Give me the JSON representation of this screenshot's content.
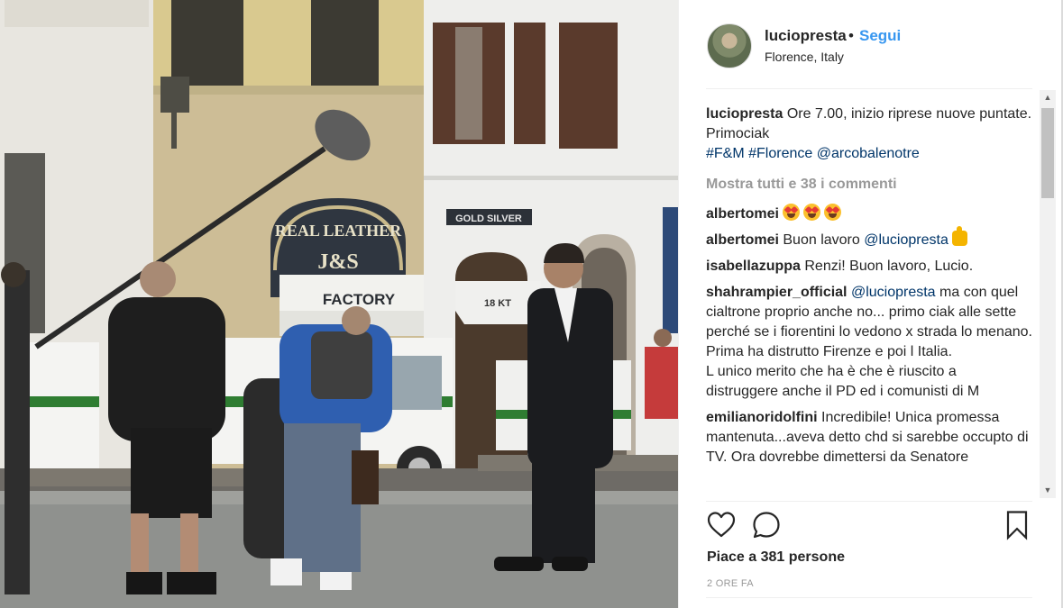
{
  "post": {
    "username": "luciopresta",
    "dot": "•",
    "follow_label": "Segui",
    "location": "Florence, Italy",
    "caption": {
      "user": "luciopresta",
      "text": "Ore 7.00, inizio riprese nuove puntate. Primociak",
      "hashtag1": "#F&M",
      "hashtag2": "#Florence",
      "mention": "@arcobalenotre"
    },
    "show_all_comments": "Mostra tutti e 38 i commenti",
    "comments": [
      {
        "user": "albertomei",
        "text": "",
        "emoji": "heart-eyes-face x3"
      },
      {
        "user": "albertomei",
        "text": "Buon lavoro",
        "mention": "@luciopresta",
        "emoji": "thumbs-up"
      },
      {
        "user": "isabellazuppa",
        "text": "Renzi! Buon lavoro, Lucio."
      },
      {
        "user": "shahrampier_official",
        "mention": "@luciopresta",
        "text": "ma con quel cialtrone proprio anche no... primo ciak alle sette perché se i fiorentini lo vedono x strada lo menano. Prima ha distrutto Firenze e poi l Italia.",
        "text2": "L unico merito che ha è che è riuscito a distruggere anche il PD ed i comunisti di M"
      },
      {
        "user": "emilianoridolfini",
        "text": "Incredibile! Unica promessa mantenuta...aveva detto chd si sarebbe occupto di TV. Ora dovrebbe dimettersi da Senatore"
      }
    ],
    "likes": "Piace a 381 persone",
    "time_ago": "2 ORE FA",
    "scroll_up": "▲",
    "scroll_down": "▼"
  },
  "photo": {
    "signs": {
      "leather": "REAL LEATHER",
      "js": "J&S",
      "factory": "FACTORY",
      "gold": "GOLD SILVER",
      "k": "18 KT"
    }
  },
  "colors": {
    "link": "#003569",
    "follow": "#3897f0",
    "muted": "#999999",
    "text": "#262626"
  }
}
